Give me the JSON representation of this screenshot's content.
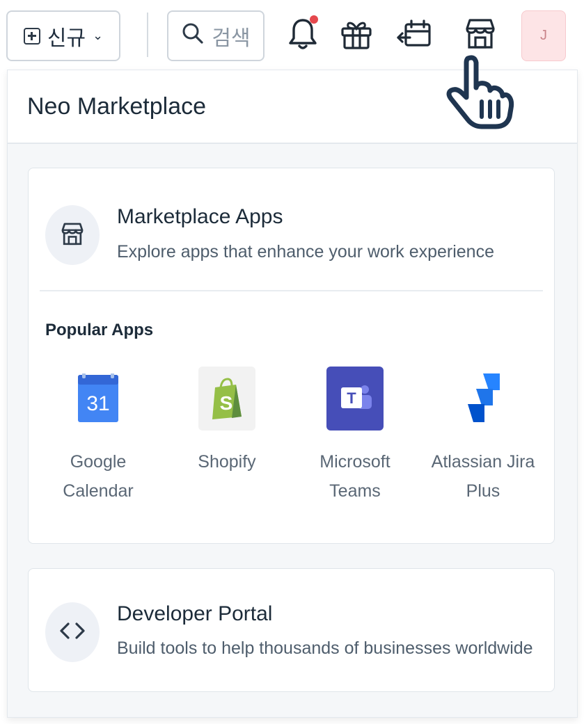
{
  "toolbar": {
    "new_label": "신규",
    "new_caret": "⌄",
    "search_label": "검색",
    "avatar_initial": "J",
    "icons": [
      "plus-square-icon",
      "search-icon",
      "bell-icon",
      "gift-icon",
      "calendar-return-icon",
      "store-icon"
    ]
  },
  "panel": {
    "title": "Neo Marketplace",
    "marketplace": {
      "heading": "Marketplace Apps",
      "subtitle": "Explore apps that enhance your work experience",
      "icon": "store-icon"
    },
    "popular": {
      "label": "Popular Apps",
      "apps": [
        {
          "name": "Google Calendar",
          "icon": "google-calendar-logo",
          "logo_text": "31"
        },
        {
          "name": "Shopify",
          "icon": "shopify-logo",
          "logo_text": "S"
        },
        {
          "name": "Microsoft Teams",
          "icon": "microsoft-teams-logo",
          "logo_text": "T"
        },
        {
          "name": "Atlassian Jira Plus",
          "icon": "jira-logo"
        }
      ]
    },
    "developer": {
      "heading": "Developer Portal",
      "subtitle": "Build tools to help thousands of businesses worldwide",
      "icon": "code-brackets-icon"
    }
  },
  "colors": {
    "accent_dark": "#1c2b39",
    "notification_dot": "#e5484d",
    "avatar_bg": "#fde4e6",
    "google_blue": "#4285f4",
    "shopify_green": "#95bf47",
    "teams_purple": "#464eb8",
    "jira_blue": "#2684ff"
  }
}
